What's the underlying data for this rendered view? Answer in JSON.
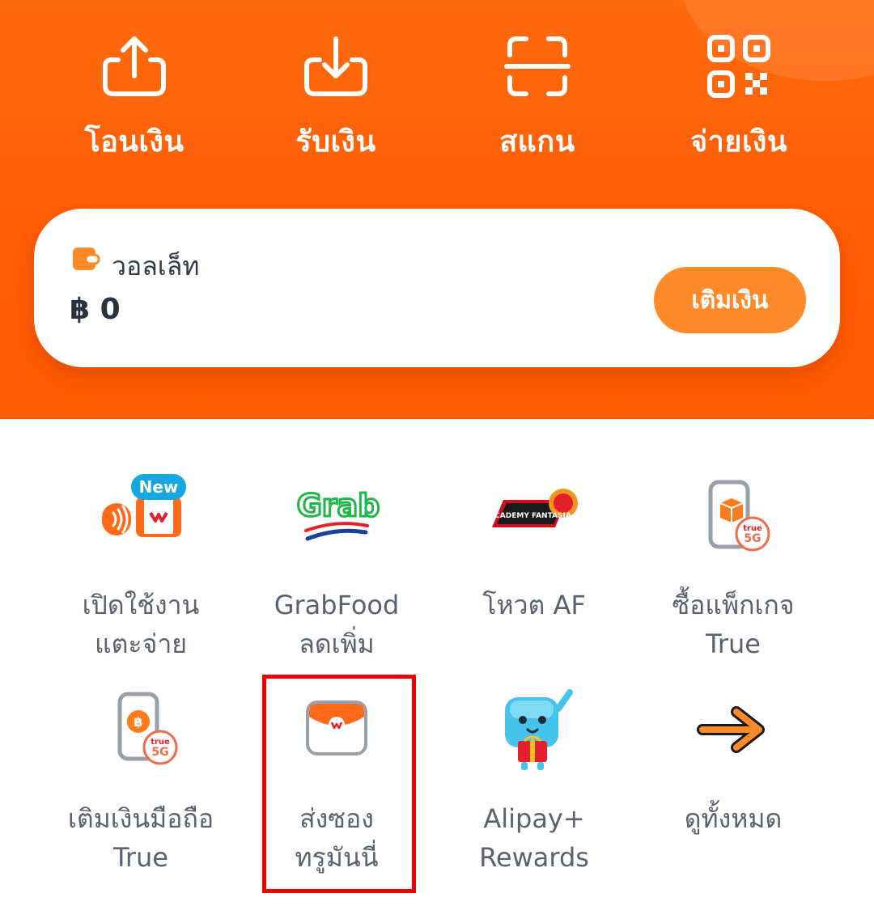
{
  "quick_actions": [
    {
      "label": "โอนเงิน",
      "icon": "send-icon"
    },
    {
      "label": "รับเงิน",
      "icon": "receive-icon"
    },
    {
      "label": "สแกน",
      "icon": "scan-icon"
    },
    {
      "label": "จ่ายเงิน",
      "icon": "qr-code-icon"
    }
  ],
  "wallet": {
    "label": "วอลเล็ท",
    "balance": "฿ 0",
    "topup_label": "เติมเงิน",
    "icon": "wallet-icon"
  },
  "services": [
    {
      "line1": "เปิดใช้งาน",
      "line2": "แตะจ่าย",
      "badge": "New",
      "icon": "tap-to-pay-icon"
    },
    {
      "line1": "GrabFood",
      "line2": "ลดเพิ่ม",
      "logo_text": "Grab",
      "icon": "grab-logo-icon"
    },
    {
      "line1": "โหวต AF",
      "line2": "",
      "logo_text": "ACADEMY FANTASIA",
      "icon": "academy-fantasia-logo-icon"
    },
    {
      "line1": "ซื้อแพ็กเกจ",
      "line2": "True",
      "badge": "true 5G",
      "icon": "package-phone-icon"
    },
    {
      "line1": "เติมเงินมือถือ",
      "line2": "True",
      "badge": "true 5G",
      "icon": "mobile-topup-icon"
    },
    {
      "line1": "ส่งซอง",
      "line2": "ทรูมันนี่",
      "icon": "red-envelope-icon"
    },
    {
      "line1": "Alipay+",
      "line2": "Rewards",
      "icon": "alipay-rewards-mascot-icon"
    },
    {
      "line1": "ดูทั้งหมด",
      "line2": "",
      "icon": "arrow-right-icon"
    }
  ],
  "colors": {
    "brand_orange": "#ff5c05",
    "button_orange": "#ff8a2a",
    "highlight_red": "#ee0000"
  }
}
